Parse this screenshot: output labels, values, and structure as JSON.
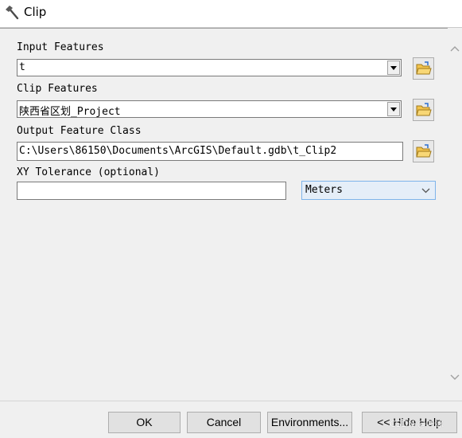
{
  "window": {
    "title": "Clip",
    "title_icon": "hammer-icon"
  },
  "form": {
    "input_features": {
      "label": "Input Features",
      "value": "t"
    },
    "clip_features": {
      "label": "Clip Features",
      "value": "陕西省区划_Project"
    },
    "output_feature_class": {
      "label": "Output Feature Class",
      "value": "C:\\Users\\86150\\Documents\\ArcGIS\\Default.gdb\\t_Clip2"
    },
    "xy_tolerance": {
      "label": "XY Tolerance (optional)",
      "value": "",
      "units": "Meters"
    }
  },
  "icons": {
    "browse": "open-folder-icon",
    "dropdown": "dropdown-arrow-icon"
  },
  "buttons": {
    "ok": "OK",
    "cancel": "Cancel",
    "environments": "Environments...",
    "hide_help": "<< Hide Help"
  },
  "watermark": "CSDN @叶冰",
  "colors": {
    "content_bg": "#f0f0f0",
    "units_bg": "#e5eef8",
    "units_border": "#7eb4ea",
    "folder_yellow": "#f2c34b"
  }
}
